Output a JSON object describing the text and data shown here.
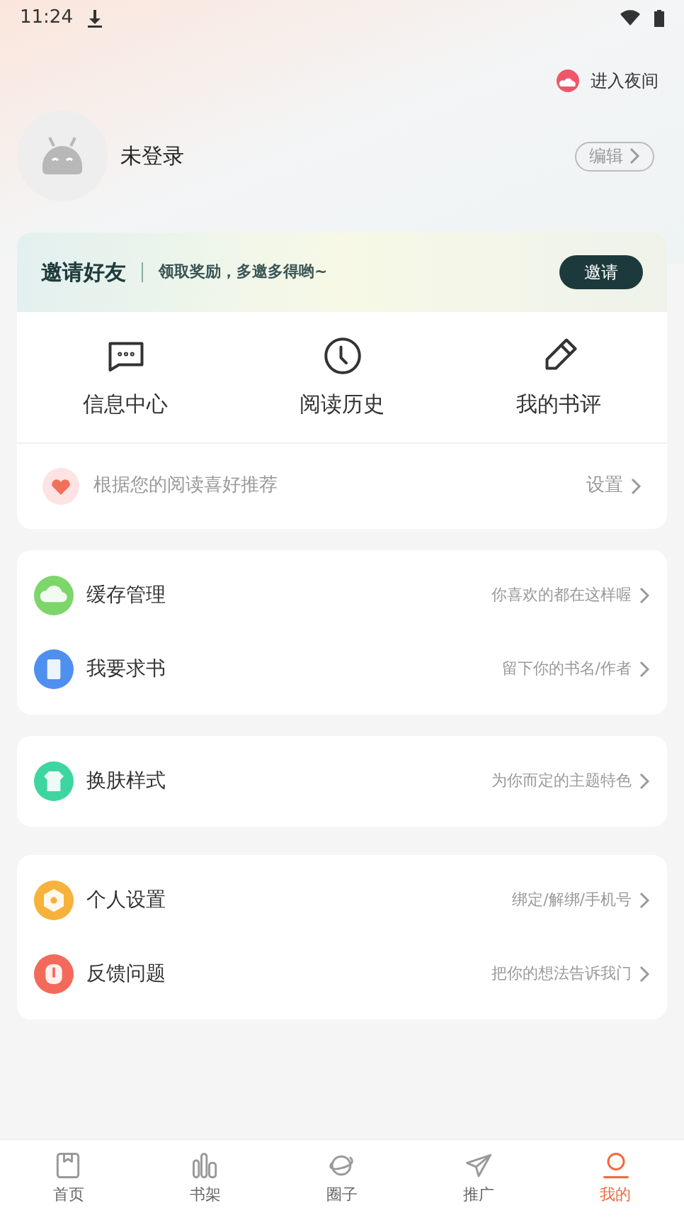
{
  "status_bar": {
    "time": "11:24"
  },
  "night_mode": {
    "label": "进入夜间"
  },
  "profile": {
    "name": "未登录",
    "edit": "编辑"
  },
  "invite": {
    "title": "邀请好友",
    "subtitle": "领取奖励，多邀多得哟~",
    "button": "邀请"
  },
  "shortcuts": [
    {
      "kind": "message",
      "label": "信息中心"
    },
    {
      "kind": "history",
      "label": "阅读历史"
    },
    {
      "kind": "review",
      "label": "我的书评"
    }
  ],
  "recommend": {
    "text": "根据您的阅读喜好推荐",
    "action": "设置"
  },
  "menu_groups": [
    [
      {
        "kind": "cloud",
        "color": "#7dd66a",
        "label": "缓存管理",
        "hint": "你喜欢的都在这样喔"
      },
      {
        "kind": "book",
        "color": "#4f8ff0",
        "label": "我要求书",
        "hint": "留下你的书名/作者"
      }
    ],
    [
      {
        "kind": "shirt",
        "color": "#3ed6a0",
        "label": "换肤样式",
        "hint": "为你而定的主题特色"
      }
    ],
    [
      {
        "kind": "gear",
        "color": "#f7b23b",
        "label": "个人设置",
        "hint": "绑定/解绑/手机号"
      },
      {
        "kind": "alert",
        "color": "#f46a5a",
        "label": "反馈问题",
        "hint": "把你的想法告诉我门"
      }
    ]
  ],
  "bottom_nav": [
    {
      "kind": "home",
      "label": "首页",
      "selected": false
    },
    {
      "kind": "shelf",
      "label": "书架",
      "selected": false
    },
    {
      "kind": "planet",
      "label": "圈子",
      "selected": false
    },
    {
      "kind": "plane",
      "label": "推广",
      "selected": false
    },
    {
      "kind": "user",
      "label": "我的",
      "selected": true
    }
  ]
}
